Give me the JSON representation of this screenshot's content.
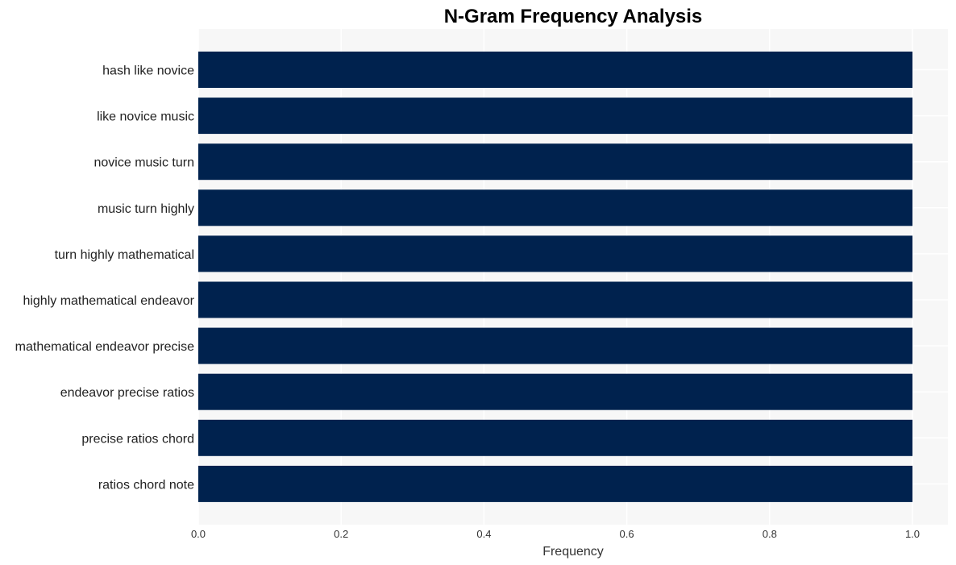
{
  "chart_data": {
    "type": "bar",
    "orientation": "horizontal",
    "title": "N-Gram Frequency Analysis",
    "xlabel": "Frequency",
    "ylabel": "",
    "categories": [
      "hash like novice",
      "like novice music",
      "novice music turn",
      "music turn highly",
      "turn highly mathematical",
      "highly mathematical endeavor",
      "mathematical endeavor precise",
      "endeavor precise ratios",
      "precise ratios chord",
      "ratios chord note"
    ],
    "values": [
      1,
      1,
      1,
      1,
      1,
      1,
      1,
      1,
      1,
      1
    ],
    "xlim": [
      0,
      1.05
    ],
    "xticks": [
      "0.0",
      "0.2",
      "0.4",
      "0.6",
      "0.8",
      "1.0"
    ],
    "grid": true,
    "legend": "none",
    "colors": {
      "bar": "#00224e",
      "plot_background": "#f7f7f7",
      "grid": "#ffffff"
    }
  }
}
